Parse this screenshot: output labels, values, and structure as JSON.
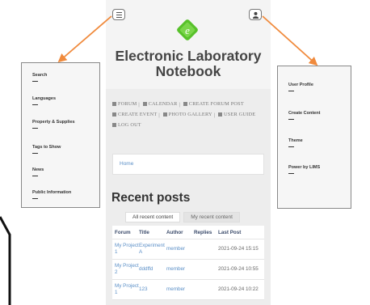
{
  "site": {
    "title": "Electronic Laboratory Notebook"
  },
  "menu": {
    "rows": [
      [
        {
          "label": "FORUM",
          "icon": "forum-icon"
        },
        {
          "label": "CALENDAR",
          "icon": "calendar-icon"
        },
        {
          "label": "CREATE FORUM POST",
          "icon": "comment-icon"
        }
      ],
      [
        {
          "label": "CREATE EVENT",
          "icon": "event-icon"
        },
        {
          "label": "PHOTO GALLERY",
          "icon": "photo-icon"
        },
        {
          "label": "USER GUIDE",
          "icon": "guide-icon"
        }
      ],
      [
        {
          "label": "LOG OUT",
          "icon": "logout-icon"
        }
      ]
    ]
  },
  "breadcrumb": {
    "home": "Home"
  },
  "recent": {
    "title": "Recent posts",
    "tabs": [
      "All recent content",
      "My recent content"
    ],
    "columns": [
      "Forum",
      "Title",
      "Author",
      "Replies",
      "Last Post"
    ],
    "rows": [
      {
        "forum": "My Project 1",
        "title": "Experiment A",
        "author": "member",
        "replies": "",
        "last_post": "2021-09-24 15:15"
      },
      {
        "forum": "My Project 2",
        "title": "dddffd",
        "author": "member",
        "replies": "",
        "last_post": "2021-09-24 10:55"
      },
      {
        "forum": "My Project 1",
        "title": "123",
        "author": "member",
        "replies": "",
        "last_post": "2021-09-24 10:22"
      }
    ]
  },
  "left_panel": {
    "items": [
      "Search",
      "Languages",
      "Property & Supplies",
      "Tags to Show",
      "News",
      "Public Information"
    ]
  },
  "right_panel": {
    "items": [
      "User Profile",
      "Create Content",
      "Theme",
      "Power by LIMS"
    ]
  },
  "colors": {
    "arrow": "#f08a3c",
    "link": "#5b8fc7",
    "logo": "#57c12a"
  }
}
